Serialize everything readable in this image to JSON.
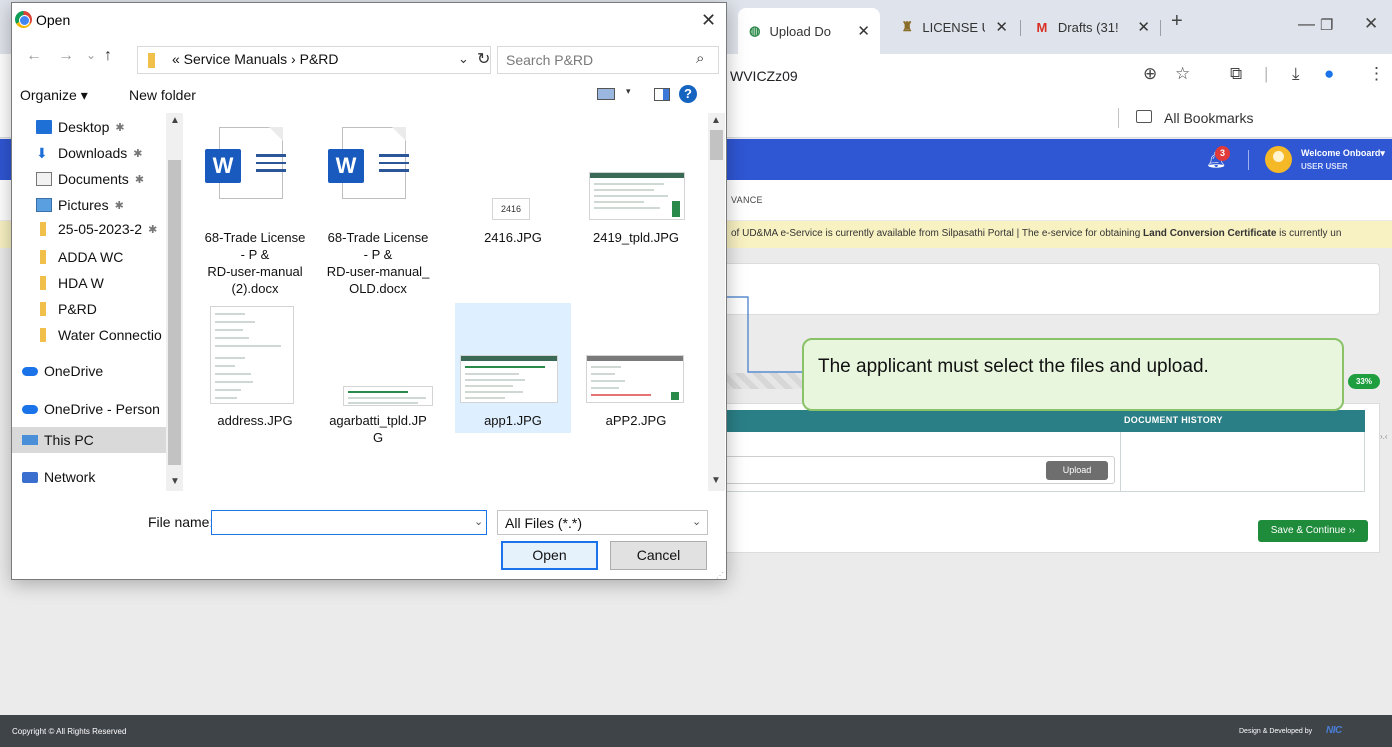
{
  "browser": {
    "tabs": [
      {
        "title": "Upload Do",
        "close": "✕"
      },
      {
        "title": "LICENSE U",
        "close": "✕"
      },
      {
        "title": "Drafts (31!",
        "close": "✕"
      }
    ],
    "new_tab": "+",
    "window_controls": {
      "minimize": "—",
      "restore": "❐",
      "close": "✕"
    },
    "address": "WVICZz09",
    "bookmarks_label": "All Bookmarks"
  },
  "app": {
    "notification_count": "3",
    "welcome": "Welcome Onboard",
    "welcome_caret": "▾",
    "user": "USER USER",
    "nav_item": "VANCE",
    "marquee_pre": "of UD&MA e-Service is currently available from Silpasathi Portal | The e-service for obtaining ",
    "marquee_bold": "Land Conversion Certificate",
    "marquee_post": " is currently un",
    "progress_pct": "33%",
    "doc_history": "DOCUMENT HISTORY",
    "upload": "Upload",
    "save_continue": "Save & Continue ››",
    "side_arrow": "›.‹",
    "copyright": "Copyright © All Rights Reserved",
    "designed_by": "Design & Developed by",
    "nic": "NIC"
  },
  "callout": {
    "text": "The applicant must select the files and upload."
  },
  "dialog": {
    "title": "Open",
    "close": "✕",
    "nav": {
      "back": "←",
      "forward": "→",
      "recent": "⌄",
      "up": "↑"
    },
    "path": "« Service Manuals › P&RD",
    "path_caret": "⌄",
    "refresh": "↻",
    "search_placeholder": "Search P&RD",
    "search_icon": "⌕",
    "organize": "Organize ▾",
    "new_folder": "New folder",
    "view_caret": "▾",
    "help": "?",
    "nav_pane": [
      {
        "label": "Desktop",
        "icon": "desktop-icon",
        "pinned": true
      },
      {
        "label": "Downloads",
        "icon": "downloads-icon",
        "pinned": true
      },
      {
        "label": "Documents",
        "icon": "documents-icon",
        "pinned": true
      },
      {
        "label": "Pictures",
        "icon": "pictures-icon",
        "pinned": true
      },
      {
        "label": "25-05-2023-2",
        "icon": "folder-icon",
        "pinned": true
      },
      {
        "label": "ADDA WC",
        "icon": "folder-icon",
        "pinned": false
      },
      {
        "label": "HDA W",
        "icon": "folder-icon",
        "pinned": false
      },
      {
        "label": "P&RD",
        "icon": "folder-icon",
        "pinned": false
      },
      {
        "label": "Water Connectio",
        "icon": "folder-icon",
        "pinned": false
      },
      {
        "label": "OneDrive",
        "icon": "onedrive-icon",
        "pinned": false
      },
      {
        "label": "OneDrive - Person",
        "icon": "onedrive-icon",
        "pinned": false
      },
      {
        "label": "This PC",
        "icon": "this-pc-icon",
        "pinned": false
      },
      {
        "label": "Network",
        "icon": "network-icon",
        "pinned": false
      }
    ],
    "pin_glyph": "📌",
    "files": [
      {
        "name": "68-Trade License\n- P &\nRD-user-manual\n(2).docx",
        "type": "word"
      },
      {
        "name": "68-Trade License\n- P &\nRD-user-manual_\nOLD.docx",
        "type": "word"
      },
      {
        "name": "2416.JPG",
        "type": "image",
        "thumb_text": "2416"
      },
      {
        "name": "2419_tpld.JPG",
        "type": "image"
      },
      {
        "name": "address.JPG",
        "type": "image"
      },
      {
        "name": "agarbatti_tpld.JP\nG",
        "type": "image"
      },
      {
        "name": "app1.JPG",
        "type": "image",
        "selected": true
      },
      {
        "name": "aPP2.JPG",
        "type": "image"
      }
    ],
    "file_name_label": "File name:",
    "file_name_value": "",
    "file_type": "All Files (*.*)",
    "open": "Open",
    "cancel": "Cancel"
  }
}
